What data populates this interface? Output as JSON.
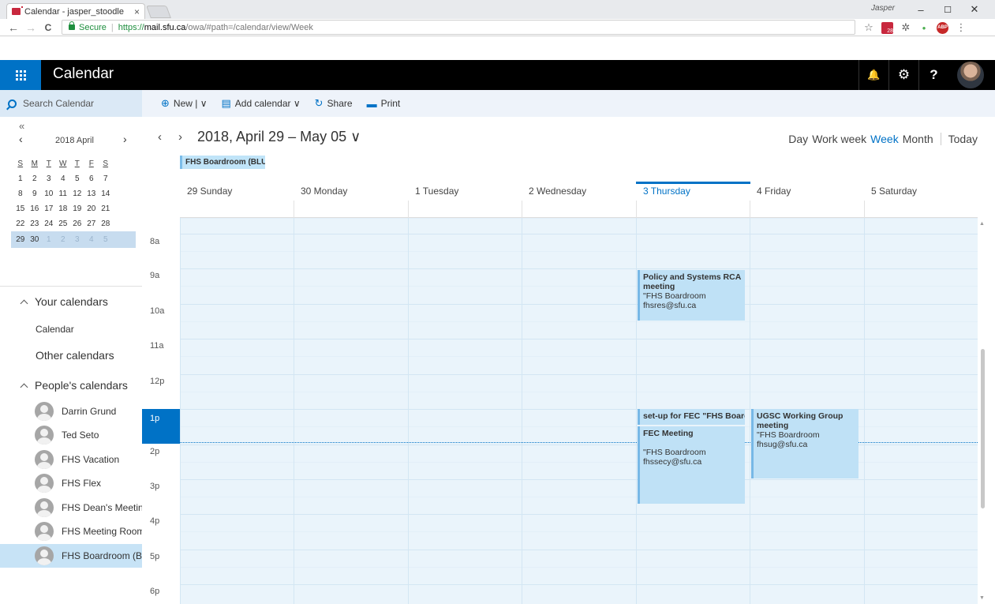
{
  "browser": {
    "tab_title": "Calendar - jasper_stoodle",
    "tab_close": "×",
    "user_label": "Jasper",
    "min_btn": "–",
    "max_btn": "☐",
    "close_btn": "✕",
    "back": "←",
    "forward": "→",
    "reload": "C",
    "secure_label": "Secure",
    "url_scheme": "https://",
    "url_host": "mail.sfu.ca",
    "url_path": "/owa/#path=/calendar/view/Week",
    "ext_cal_num": "28",
    "ext_abp": "ABP",
    "star": "☆",
    "puzzle": "✲",
    "dots": "⋮"
  },
  "header": {
    "app_title": "Calendar",
    "bell": "🔔",
    "gear": "⚙",
    "help": "?"
  },
  "left": {
    "search_placeholder": "Search Calendar",
    "collapse": "«",
    "prev": "‹",
    "next": "›",
    "month_label": "2018 April",
    "dow": [
      "S",
      "M",
      "T",
      "W",
      "T",
      "F",
      "S"
    ],
    "weeks": [
      [
        "1",
        "2",
        "3",
        "4",
        "5",
        "6",
        "7"
      ],
      [
        "8",
        "9",
        "10",
        "11",
        "12",
        "13",
        "14"
      ],
      [
        "15",
        "16",
        "17",
        "18",
        "19",
        "20",
        "21"
      ],
      [
        "22",
        "23",
        "24",
        "25",
        "26",
        "27",
        "28"
      ],
      [
        "29",
        "30",
        "1",
        "2",
        "3",
        "4",
        "5"
      ]
    ],
    "your_calendars": "Your calendars",
    "calendar_item": "Calendar",
    "other_calendars": "Other calendars",
    "peoples_calendars": "People's calendars",
    "people": [
      "Darrin Grund",
      "Ted Seto",
      "FHS Vacation",
      "FHS Flex",
      "FHS Dean's Meeting",
      "FHS Meeting Room (",
      "FHS Boardroom (BLU"
    ]
  },
  "toolbar": {
    "new_glyph": "⊕",
    "new_label": "New | ∨",
    "add_glyph": "▤",
    "add_label": "Add calendar ∨",
    "share_glyph": "↻",
    "share_label": "Share",
    "print_glyph": "▬",
    "print_label": "Print"
  },
  "calendar": {
    "prev": "‹",
    "next": "›",
    "range": "2018, April 29 – May 05 ∨",
    "views": {
      "day": "Day",
      "work_week": "Work week",
      "week": "Week",
      "month": "Month",
      "today": "Today"
    },
    "chip": "FHS Boardroom (BLU",
    "days": [
      "29 Sunday",
      "30 Monday",
      "1 Tuesday",
      "2 Wednesday",
      "3 Thursday",
      "4 Friday",
      "5 Saturday"
    ],
    "hours": [
      "8a",
      "9a",
      "10a",
      "11a",
      "12p",
      "1p",
      "2p",
      "3p",
      "4p",
      "5p",
      "6p"
    ]
  },
  "events": [
    {
      "title": "Policy and Systems RCA meeting",
      "loc": "\"FHS Boardroom",
      "mail": "fhsres@sfu.ca"
    },
    {
      "title": "set-up for FEC \"FHS Boarc",
      "loc": "",
      "mail": ""
    },
    {
      "title": "FEC Meeting",
      "loc": "\"FHS Boardroom",
      "mail": "fhssecy@sfu.ca"
    },
    {
      "title": "UGSC Working Group meeting",
      "loc": "\"FHS Boardroom",
      "mail": "fhsug@sfu.ca"
    }
  ]
}
